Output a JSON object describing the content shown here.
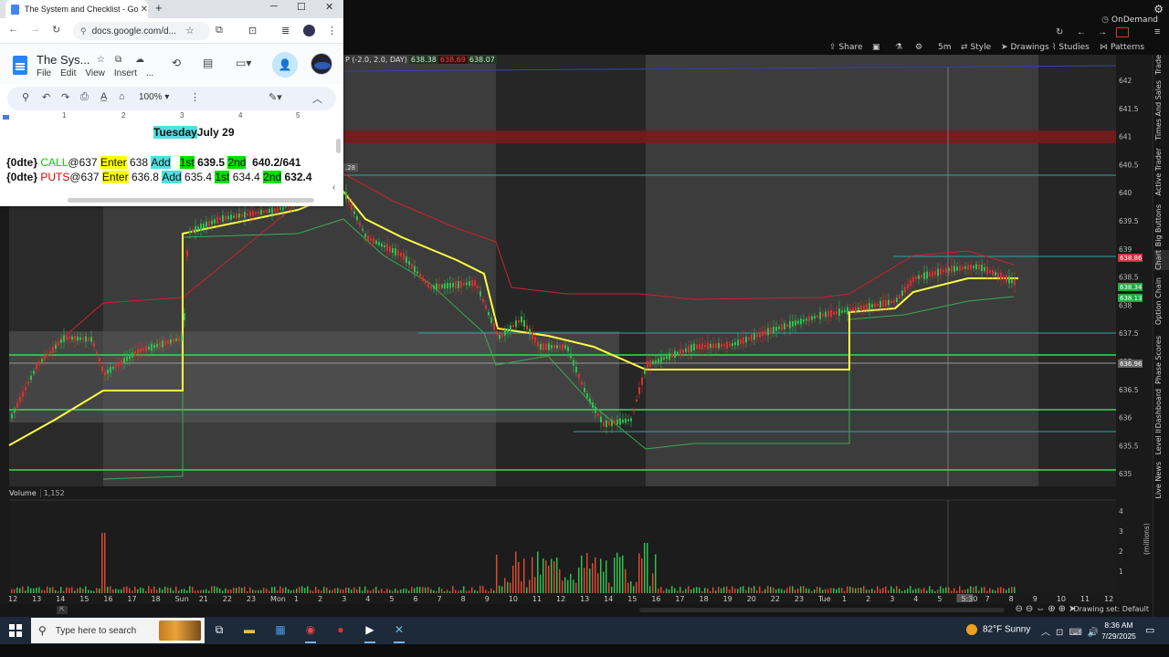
{
  "browser": {
    "tab_title": "The System and Checklist - Go",
    "new_tab": "+",
    "url": "docs.google.com/d...",
    "win_min": "─",
    "win_max": "☐",
    "win_close": "✕"
  },
  "doc": {
    "title": "The Sys...",
    "menus": [
      "File",
      "Edit",
      "View",
      "Insert",
      "..."
    ],
    "zoom": "100%",
    "ruler": [
      "1",
      "2",
      "3",
      "4",
      "5"
    ],
    "heading_day": "Tuesday",
    "heading_date": "July 29",
    "call_line": {
      "prefix": "{0dte}",
      "side": "CALL",
      "strike": "@637",
      "enter_label": "Enter",
      "enter": "638",
      "add_label": "Add",
      "add": "",
      "first_label": "1st",
      "first": "639.5",
      "second_label": "2nd",
      "second": "640.2/641"
    },
    "puts_line": {
      "prefix": "{0dte}",
      "side": "PUTS",
      "strike": "@637",
      "enter_label": "Enter",
      "enter": "636.8",
      "add_label": "Add",
      "add": "635.4",
      "first_label": "1st",
      "first": "634.4",
      "second_label": "2nd",
      "second": "632.4"
    }
  },
  "platform": {
    "ondemand": "OnDemand",
    "toolbar": {
      "share": "Share",
      "timeframe": "5m",
      "style": "Style",
      "drawings": "Drawings",
      "studies": "Studies",
      "patterns": "Patterns"
    },
    "study_header": {
      "params": "P (-2.0, 2.0, DAY)",
      "v1": "638.38",
      "v2": "638.69",
      "v3": "638.07",
      "crosshair_tag": ".28"
    },
    "side_tabs": [
      "Trade",
      "Times And Sales",
      "Active Trader",
      "Big Buttons",
      "Chart",
      "Option Chain",
      "Phase Scores",
      "Dashboard",
      "Level II",
      "Live News"
    ],
    "price_axis": [
      "642",
      "641.5",
      "641",
      "640.5",
      "640",
      "639.5",
      "639",
      "638.5",
      "638",
      "637.5",
      "637",
      "636.5",
      "636",
      "635.5",
      "635"
    ],
    "price_tags": {
      "red": "638.86",
      "green1": "638.34",
      "green2": "638.13",
      "gray": "636.96"
    },
    "volume_label": "Volume",
    "volume_value": "1,152",
    "volume_axis": [
      "4",
      "3",
      "2",
      "1"
    ],
    "volume_unit": "(millions)",
    "x_axis": [
      "12",
      "13",
      "14",
      "15",
      "16",
      "17",
      "18",
      "Sun",
      "21",
      "22",
      "23",
      "Mon",
      "1",
      "2",
      "3",
      "4",
      "5",
      "6",
      "7",
      "8",
      "9",
      "10",
      "11",
      "12",
      "13",
      "14",
      "15",
      "16",
      "17",
      "18",
      "19",
      "20",
      "22",
      "23",
      "Tue",
      "1",
      "2",
      "3",
      "4",
      "5",
      "5:30",
      "7",
      "8",
      "9",
      "10",
      "11",
      "12"
    ],
    "drawing_set": "Drawing set: Default"
  },
  "taskbar": {
    "search_placeholder": "Type here to search",
    "weather": "82°F  Sunny",
    "time": "8:36 AM",
    "date": "7/29/2025"
  },
  "colors": {
    "vwap": "#ffff44",
    "levels": "#33dd55",
    "band_red": "#cc2233",
    "resistance": "#8b1a1a"
  }
}
